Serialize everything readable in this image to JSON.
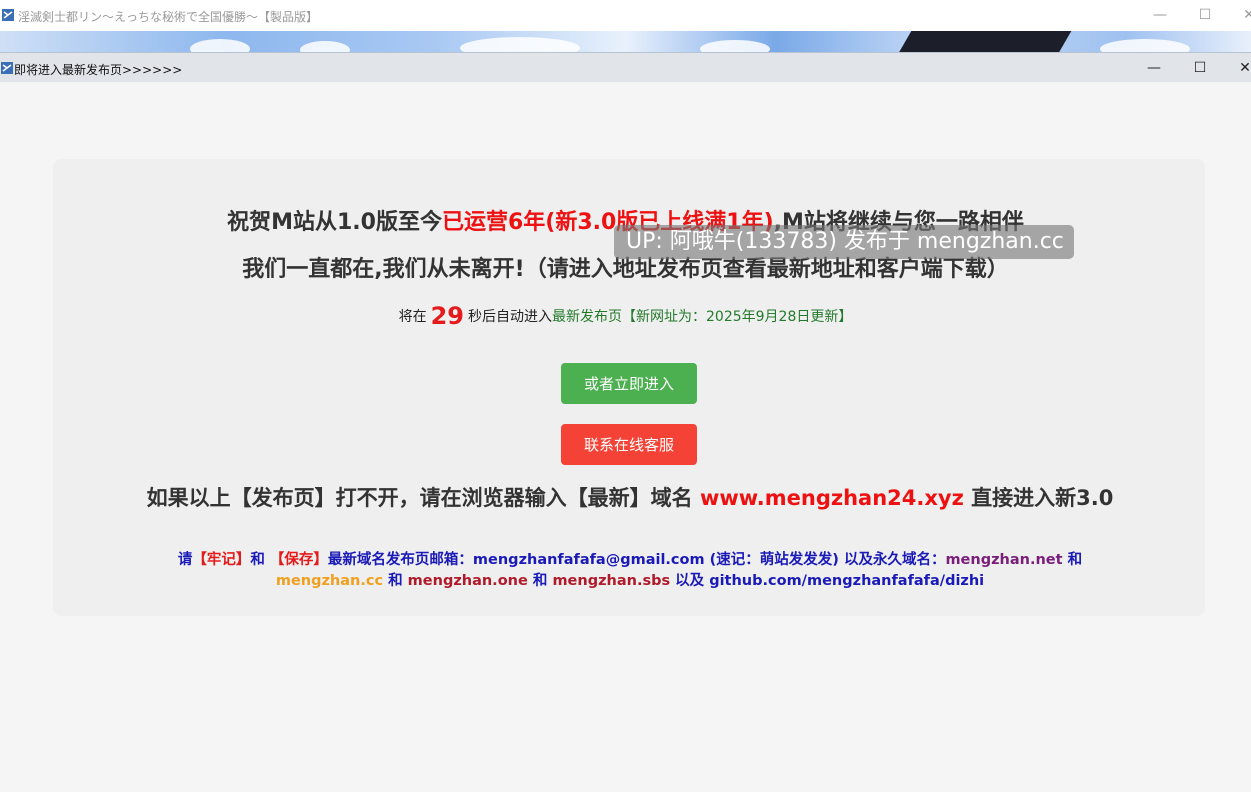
{
  "background_window": {
    "title": "淫滅剣士都リン～えっちな秘術で全国優勝～【製品版】",
    "controls": {
      "minimize": "—",
      "maximize": "☐",
      "close": "✕"
    }
  },
  "dialog": {
    "title": "即将进入最新发布页>>>>>>",
    "controls": {
      "minimize": "—",
      "maximize": "☐",
      "close": "✕"
    }
  },
  "headline1": {
    "part1": "祝贺M站从1.0版至今",
    "highlight": "已运营6年(新3.0版已上线满1年)",
    "part2": ",M站将继续与您一路相伴"
  },
  "headline2": "我们一直都在,我们从未离开!（请进入地址发布页查看最新地址和客户端下载）",
  "watermark": "UP: 阿哦牛(133783) 发布于 mengzhan.cc",
  "countdown": {
    "prefix": "将在",
    "seconds": "29",
    "middle": "秒后自动进入",
    "link": "最新发布页【新网址为：2025年9月28日更新】"
  },
  "buttons": {
    "enter_now": "或者立即进入",
    "contact": "联系在线客服"
  },
  "fallback": {
    "prefix": "如果以上【发布页】打不开，请在浏览器输入【最新】域名",
    "domain": "www.mengzhan24.xyz",
    "suffix": "直接进入新3.0"
  },
  "note": {
    "t1": "请",
    "remember": "【牢记】",
    "t2": "和 ",
    "save": "【保存】",
    "t3": "最新域名发布页邮箱：mengzhanfafafa@gmail.com (速记：萌站发发发) 以及永久域名：",
    "d1": "mengzhan.net",
    "t4": " 和 ",
    "d2": "mengzhan.cc",
    "t5": " 和 ",
    "d3": "mengzhan.one",
    "t6": " 和 ",
    "d4": "mengzhan.sbs",
    "t7": " 以及 github.com/mengzhanfafafa/dizhi"
  },
  "colors": {
    "accent_red": "#ee1111",
    "button_green": "#4caf50",
    "button_red": "#f44336",
    "note_blue": "#1a1ab8"
  }
}
